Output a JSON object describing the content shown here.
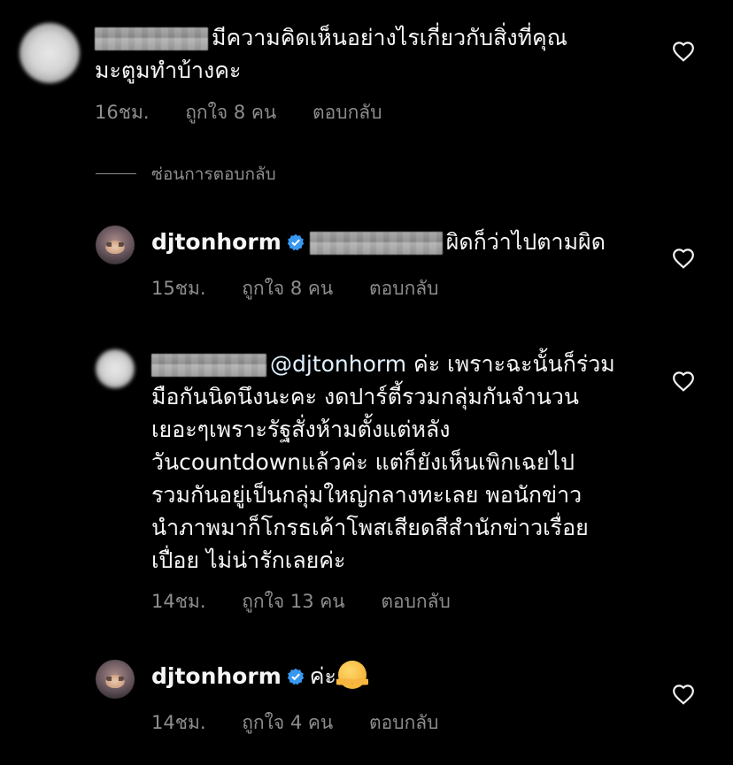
{
  "comments": [
    {
      "id": "c1",
      "username_hidden": true,
      "lines": [
        "มีความคิดเห็นอย่างไรเกี่ยวกับสิ่งที่คุณ",
        "มะตูมทำบ้างคะ"
      ],
      "time": "16ชม.",
      "likes": "ถูกใจ 8 คน",
      "reply": "ตอบกลับ"
    },
    {
      "id": "c2",
      "username": "djtonhorm",
      "verified": true,
      "mention_hidden": true,
      "lines": [
        "ผิดก็ว่าไปตามผิด"
      ],
      "time": "15ชม.",
      "likes": "ถูกใจ 8 คน",
      "reply": "ตอบกลับ"
    },
    {
      "id": "c3",
      "username_hidden": true,
      "mention": "@djtonhorm",
      "lines": [
        "ค่ะ เพราะฉะนั้นก็ร่วม",
        "มือกันนิดนึงนะคะ งดปาร์ตี้รวมกลุ่มกันจำนวน",
        "เยอะๆเพราะรัฐสั่งห้ามตั้งแต่หลัง",
        "วันcountdownแล้วค่ะ แต่ก็ยังเห็นเพิกเฉยไป",
        "รวมกันอยู่เป็นกลุ่มใหญ่กลางทะเลย พอนักข่าว",
        "นำภาพมาก็โกรธเค้าโพสเสียดสีสำนักข่าวเรื่อย",
        "เปื่อย ไม่น่ารักเลยค่ะ"
      ],
      "time": "14ชม.",
      "likes": "ถูกใจ 13 คน",
      "reply": "ตอบกลับ"
    },
    {
      "id": "c4",
      "username": "djtonhorm",
      "verified": true,
      "lines": [
        "ค่ะ"
      ],
      "emoji": "hugging-face",
      "time": "14ชม.",
      "likes": "ถูกใจ 4 คน",
      "reply": "ตอบกลับ"
    }
  ],
  "hide_replies_label": "ซ่อนการตอบกลับ",
  "colors": {
    "background": "#000000",
    "text": "#f5f5f5",
    "muted": "#8e8e8e",
    "mention": "#e0f1ff",
    "verified": "#3897f0"
  },
  "icons": [
    "heart-icon",
    "verified-badge-icon",
    "hugging-face-emoji"
  ]
}
